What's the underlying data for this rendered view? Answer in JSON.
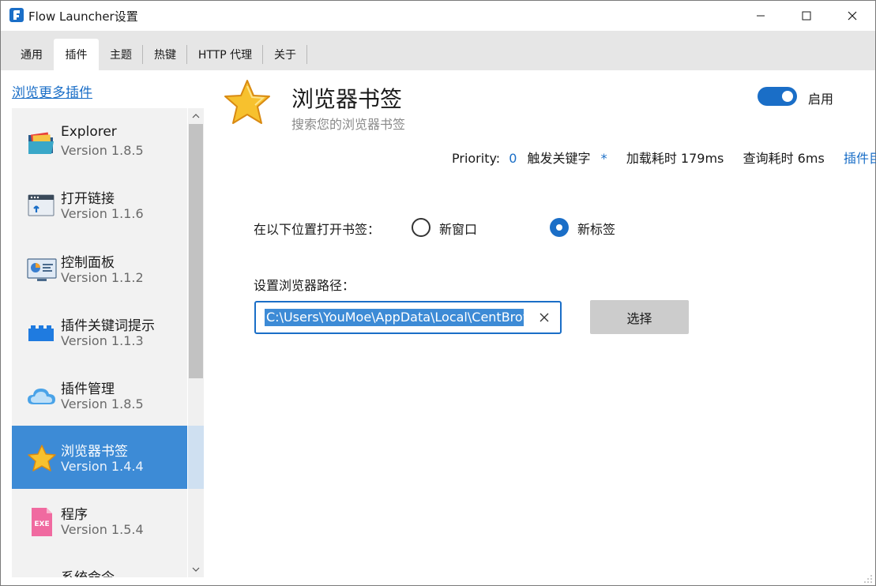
{
  "window": {
    "title": "Flow Launcher设置"
  },
  "tabs": [
    {
      "label": "通用",
      "active": false
    },
    {
      "label": "插件",
      "active": true
    },
    {
      "label": "主题",
      "active": false
    },
    {
      "label": "热键",
      "active": false
    },
    {
      "label": "HTTP 代理",
      "active": false
    },
    {
      "label": "关于",
      "active": false
    }
  ],
  "sidebar": {
    "more_link": "浏览更多插件",
    "plugins": [
      {
        "name": "Explorer",
        "version": "Version 1.8.5",
        "icon": "folder-icon",
        "selected": false
      },
      {
        "name": "打开链接",
        "version": "Version 1.1.6",
        "icon": "browser-window-icon",
        "selected": false
      },
      {
        "name": "控制面板",
        "version": "Version 1.1.2",
        "icon": "control-panel-icon",
        "selected": false
      },
      {
        "name": "插件关键词提示",
        "version": "Version 1.1.3",
        "icon": "blocks-icon",
        "selected": false
      },
      {
        "name": "插件管理",
        "version": "Version 1.8.5",
        "icon": "cloud-icon",
        "selected": false
      },
      {
        "name": "浏览器书签",
        "version": "Version 1.4.4",
        "icon": "star-icon",
        "selected": true
      },
      {
        "name": "程序",
        "version": "Version 1.5.4",
        "icon": "exe-file-icon",
        "selected": false
      },
      {
        "name": "系统命令",
        "version": "",
        "icon": "search-icon",
        "selected": false
      }
    ]
  },
  "main": {
    "title": "浏览器书签",
    "subtitle": "搜索您的浏览器书签",
    "enabled_label": "启用",
    "enabled": true,
    "meta": {
      "priority_label": "Priority:",
      "priority_value": "0",
      "keyword_label": "触发关键字",
      "keyword_value": "*",
      "load_time": "加载耗时 179ms",
      "query_time": "查询耗时 6ms",
      "plugin_dir_link": "插件目录"
    },
    "open_in": {
      "label": "在以下位置打开书签：",
      "options": [
        {
          "label": "新窗口",
          "checked": false
        },
        {
          "label": "新标签",
          "checked": true
        }
      ]
    },
    "browser_path": {
      "label": "设置浏览器路径：",
      "value": "C:\\Users\\YouMoe\\AppData\\Local\\CentBrowser\\Application\\chrome.exe",
      "choose_label": "选择"
    }
  },
  "colors": {
    "accent": "#1a6ec7",
    "selected_item": "#3d8bd6",
    "sidebar_bg": "#f2f2f2",
    "tab_strip": "#e6e6e6"
  }
}
